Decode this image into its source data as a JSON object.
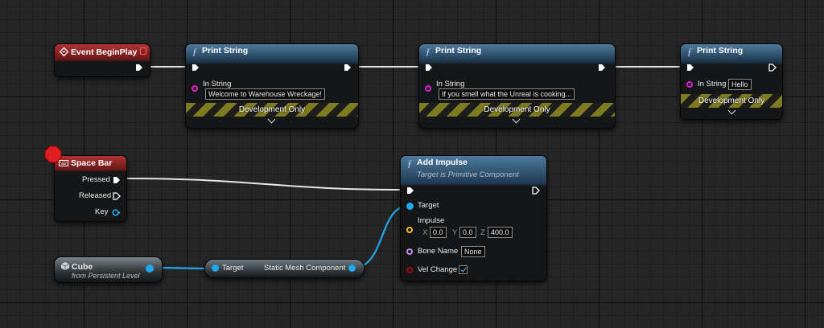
{
  "colors": {
    "exec_pin": "#ffffff",
    "object_pin": "#1fa8ea",
    "string_pin": "#e01fd0",
    "vector_pin": "#f0c11e",
    "name_pin": "#c38fe8",
    "bool_pin": "#9c0f0f",
    "event_header": "#9a2a2a",
    "function_header": "#3b6485",
    "breakpoint": "#e02020"
  },
  "nodes": {
    "event_begin_play": {
      "title": "Event BeginPlay",
      "icon": "event-diamond-icon"
    },
    "print_string_1": {
      "title": "Print String",
      "in_string_label": "In String",
      "in_string_value": "Welcome to Warehouse Wreckage!",
      "dev_only": "Development Only"
    },
    "print_string_2": {
      "title": "Print String",
      "in_string_label": "In String",
      "in_string_value": "If you smell what the Unreal is cooking...",
      "dev_only": "Development Only"
    },
    "print_string_3": {
      "title": "Print String",
      "in_string_label": "In String",
      "in_string_value": "Hello",
      "dev_only": "Development Only"
    },
    "space_bar": {
      "title": "Space Bar",
      "icon": "keyboard-icon",
      "pins": [
        "Pressed",
        "Released",
        "Key"
      ]
    },
    "add_impulse": {
      "title": "Add Impulse",
      "subtitle": "Target is Primitive Component",
      "target_label": "Target",
      "impulse_label": "Impulse",
      "impulse": {
        "x_label": "X",
        "x": "0.0",
        "y_label": "Y",
        "y": "0.0",
        "z_label": "Z",
        "z": "400.0"
      },
      "bone_name_label": "Bone Name",
      "bone_name_value": "None",
      "vel_change_label": "Vel Change",
      "vel_change_checked": true
    },
    "cube": {
      "title": "Cube",
      "subtitle": "from Persistent Level",
      "icon": "cube-icon"
    },
    "static_mesh_getter": {
      "target_label": "Target",
      "output_label": "Static Mesh Component"
    }
  }
}
